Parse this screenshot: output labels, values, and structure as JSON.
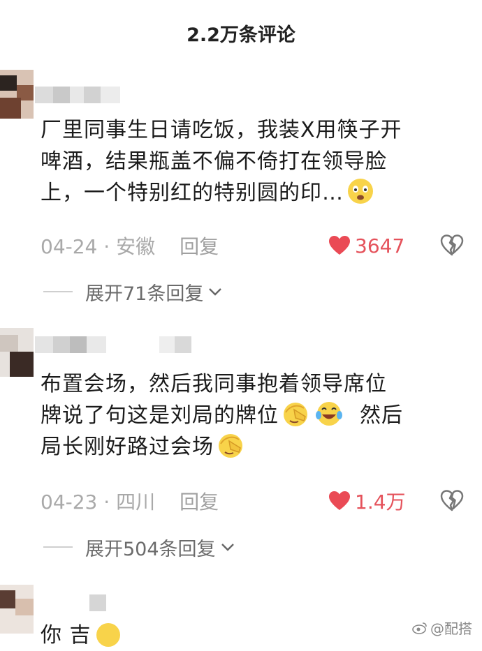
{
  "header": {
    "title": "2.2万条评论"
  },
  "comments": [
    {
      "text_lines": [
        "厂里同事生日请吃饭，我装X用筷子开",
        "啤酒，结果瓶盖不偏不倚打在领导脸",
        "上，一个特别红的特别圆的印…"
      ],
      "date": "04-24",
      "location": "安徽",
      "reply_label": "回复",
      "likes": "3647",
      "expand_label": "展开71条回复"
    },
    {
      "text_lines": [
        "布置会场，然后我同事抱着领导席位",
        "牌说了句这是刘局的牌位",
        "然后",
        "局长刚好路过会场"
      ],
      "date": "04-23",
      "location": "四川",
      "reply_label": "回复",
      "likes": "1.4万",
      "expand_label": "展开504条回复"
    }
  ],
  "partial_comment": {
    "text": "你 吉"
  },
  "watermark": {
    "text": "@配搭"
  },
  "colors": {
    "like": "#e5525b",
    "meta": "#a9a9a9",
    "text": "#1b1b1b"
  },
  "icons": [
    "heart-filled-icon",
    "broken-heart-icon",
    "chevron-down-icon",
    "weibo-icon"
  ]
}
